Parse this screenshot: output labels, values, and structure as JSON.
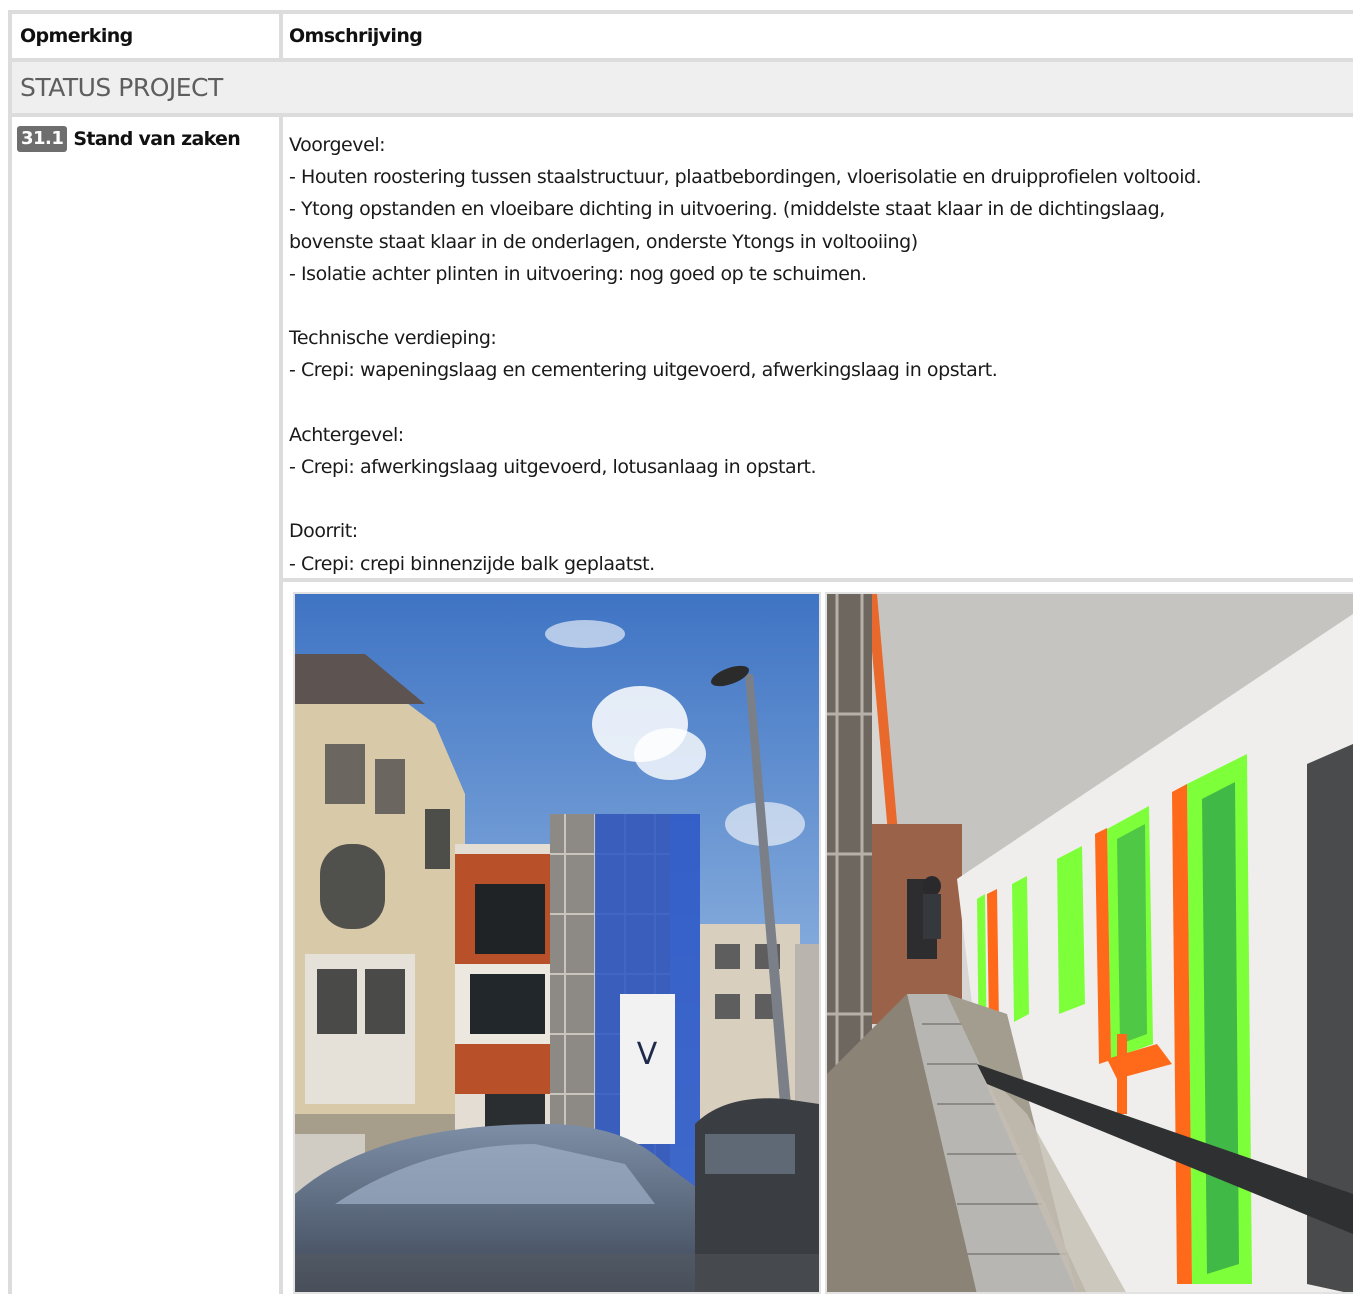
{
  "table": {
    "header": {
      "col1": "Opmerking",
      "col2": "Omschrijving"
    },
    "section_title": "STATUS PROJECT",
    "item": {
      "number": "31.1",
      "title": "Stand van zaken",
      "description_lines": [
        "Voorgevel:",
        "- Houten roostering tussen staalstructuur, plaatbebordingen, vloerisolatie en druipprofielen voltooid.",
        "- Ytong opstanden en vloeibare dichting in uitvoering. (middelste staat klaar in de dichtingslaag,",
        "bovenste staat klaar in de onderlagen, onderste Ytongs in voltooiing)",
        "- Isolatie achter plinten in uitvoering: nog goed op te schuimen.",
        "",
        "Technische verdieping:",
        "- Crepi: wapeningslaag en cementering uitgevoerd, afwerkingslaag in opstart.",
        "",
        "Achtergevel:",
        "- Crepi: afwerkingslaag uitgevoerd, lotusanlaag in opstart.",
        "",
        "Doorrit:",
        "- Crepi: crepi binnenzijde balk geplaatst."
      ]
    }
  },
  "colors": {
    "grid": "#dcdcdc",
    "section_bg": "#efefef",
    "badge_bg": "#6e6e6e",
    "tape_green": "#7dff3a",
    "tape_orange": "#ff6a1a"
  },
  "photos": [
    {
      "icon": "building-facade-photo"
    },
    {
      "icon": "gallery-wall-photo"
    }
  ]
}
